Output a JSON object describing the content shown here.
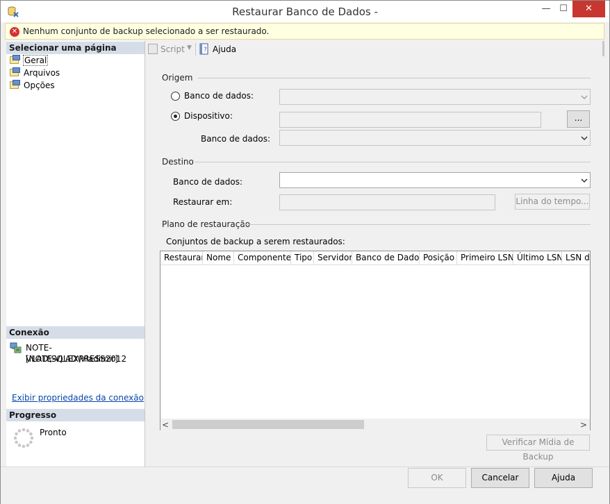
{
  "window": {
    "title": "Restaurar Banco de Dados -",
    "minimize_glyph": "—",
    "maximize_glyph": "☐",
    "close_glyph": "✕"
  },
  "message": {
    "icon": "error-icon",
    "text": "Nenhum conjunto de backup selecionado a ser restaurado."
  },
  "left": {
    "select_page_header": "Selecionar uma página",
    "pages": [
      {
        "label": "Geral",
        "selected": true
      },
      {
        "label": "Arquivos",
        "selected": false
      },
      {
        "label": "Opções",
        "selected": false
      }
    ],
    "connection_header": "Conexão",
    "connection_server": "NOTE-VLAD\\SQLEXPRESS2012",
    "connection_user": "[NOTE-VLAD\\Vladimir]",
    "connection_link": "Exibir propriedades da conexão",
    "progress_header": "Progresso",
    "progress_status": "Pronto"
  },
  "toolbar": {
    "script_label": "Script",
    "script_arrow": "▼",
    "help_label": "Ajuda"
  },
  "source": {
    "group_label": "Origem",
    "database_radio_label": "Banco de dados:",
    "device_radio_label": "Dispositivo:",
    "selected": "device",
    "device_browse_label": "...",
    "device_database_label": "Banco de dados:"
  },
  "destination": {
    "group_label": "Destino",
    "database_label": "Banco de dados:",
    "restore_to_label": "Restaurar em:",
    "timeline_button": "Linha do tempo..."
  },
  "plan": {
    "group_label": "Plano de restauração",
    "sets_label": "Conjuntos de backup a serem restaurados:",
    "columns": [
      "Restaurar",
      "Nome",
      "Componente",
      "Tipo",
      "Servidor",
      "Banco de Dados",
      "Posição",
      "Primeiro LSN",
      "Último LSN",
      "LSN do"
    ],
    "scroll_left": "<",
    "scroll_right": ">",
    "verify_button": "Verificar Mídia de Backup"
  },
  "buttons": {
    "ok": "OK",
    "cancel": "Cancelar",
    "help": "Ajuda"
  },
  "colors": {
    "accent_close": "#c7372f",
    "message_bg": "#ffffe1",
    "section_header_bg": "#d5dde8",
    "link": "#0645ad"
  }
}
